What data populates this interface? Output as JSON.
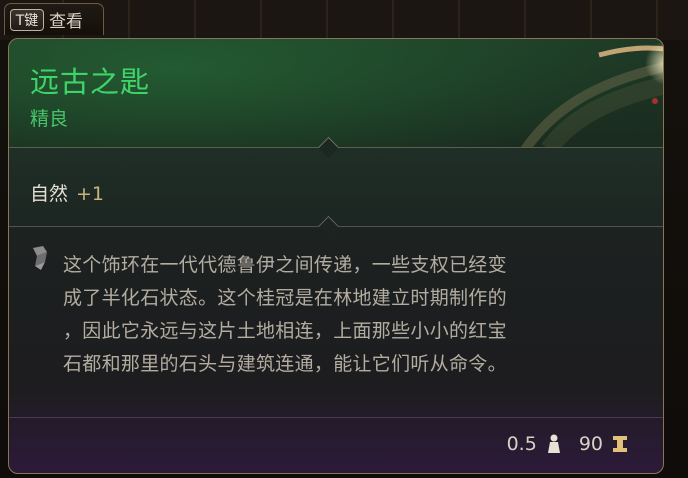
{
  "tab": {
    "key_label": "T键",
    "label": "查看"
  },
  "item": {
    "name": "远古之匙",
    "rarity": "精良",
    "stat": {
      "name": "自然",
      "value": "+1"
    },
    "description_lines": [
      "这个饰环在一代代德鲁伊之间传递，一些支权已经变",
      "成了半化石状态。这个桂冠是在林地建立时期制作的",
      "，因此它永远与这片土地相连，上面那些小小的红宝",
      "石都和那里的石头与建筑连通，能让它们听从命令。"
    ],
    "weight": "0.5",
    "price": "90"
  },
  "icons": {
    "description": "quill-icon",
    "weight": "weight-icon",
    "price": "coin-icon"
  },
  "colors": {
    "name": "#3fd46a",
    "rarity": "#49c46a",
    "stat_bonus": "#c9b47a",
    "border": "#8a7655"
  }
}
